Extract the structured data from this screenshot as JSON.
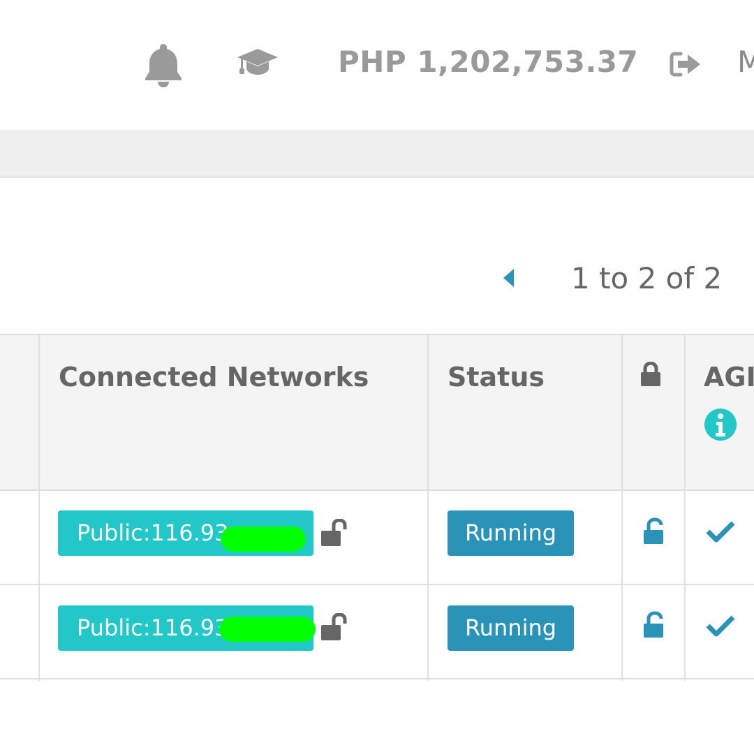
{
  "header": {
    "balance": "PHP 1,202,753.37",
    "menu_partial": "M",
    "icons": {
      "notifications": "bell-icon",
      "learning": "graduation-cap-icon",
      "logout": "sign-out-icon"
    }
  },
  "pager": {
    "prev_icon": "caret-left-icon",
    "range_text": "1 to 2 of 2"
  },
  "table": {
    "columns": [
      {
        "label": "Connected Networks"
      },
      {
        "label": "Status"
      },
      {
        "label": "",
        "icon": "lock-icon"
      },
      {
        "label": "AGI",
        "icon": "info-icon"
      }
    ],
    "rows": [
      {
        "network": "Public:116.93.",
        "network_lock_icon": "unlock-icon",
        "status": "Running",
        "lock_icon": "unlock-icon",
        "agi_icon": "check-icon"
      },
      {
        "network": "Public:116.93.",
        "network_lock_icon": "unlock-icon",
        "status": "Running",
        "lock_icon": "unlock-icon",
        "agi_icon": "check-icon"
      }
    ]
  },
  "colors": {
    "network_pill": "#22c7c7",
    "status_running": "#2a93b8",
    "accent_icon": "#2a93b8",
    "info_icon": "#22c7c7",
    "redaction": "#00ff00",
    "header_icons": "#9a9a9a"
  }
}
